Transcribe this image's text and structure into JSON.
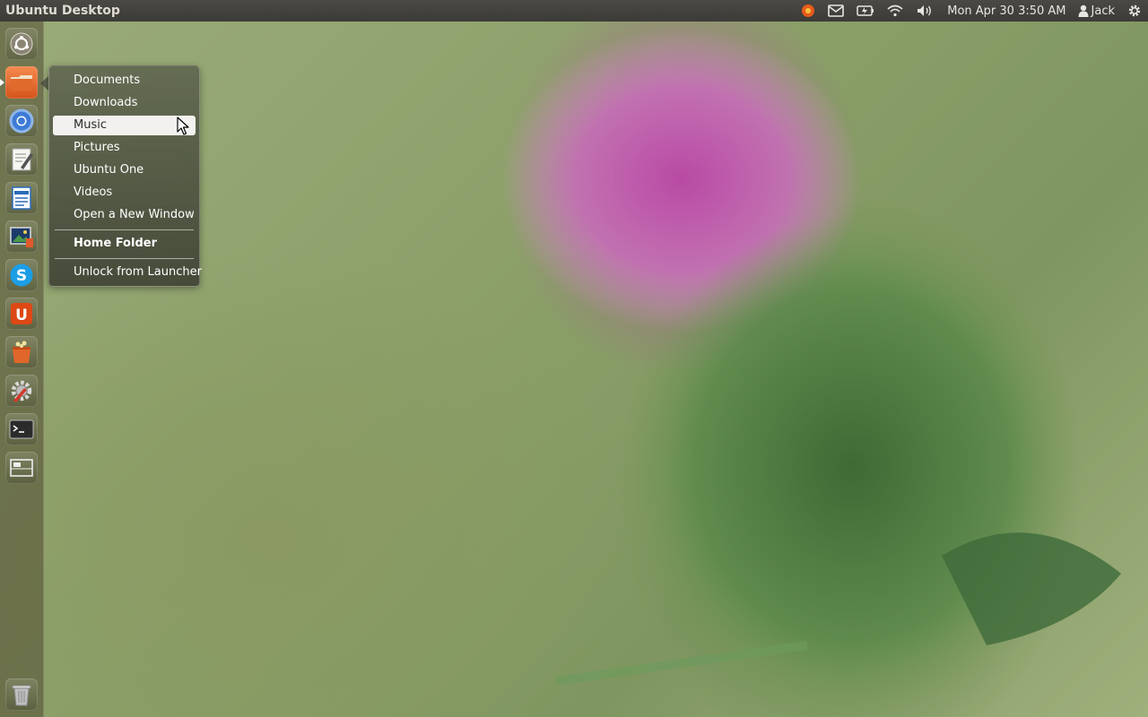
{
  "panel": {
    "title": "Ubuntu Desktop",
    "clock": "Mon Apr 30  3:50 AM",
    "user": "Jack"
  },
  "launcher": {
    "items": [
      {
        "name": "dash-home-icon"
      },
      {
        "name": "home-folder-icon",
        "running": true
      },
      {
        "name": "chromium-icon"
      },
      {
        "name": "text-editor-icon"
      },
      {
        "name": "libreoffice-writer-icon"
      },
      {
        "name": "image-viewer-icon"
      },
      {
        "name": "skype-icon"
      },
      {
        "name": "ubuntu-one-icon"
      },
      {
        "name": "software-center-icon"
      },
      {
        "name": "system-settings-icon"
      },
      {
        "name": "terminal-icon"
      },
      {
        "name": "workspace-switcher-icon"
      },
      {
        "name": "trash-icon"
      }
    ]
  },
  "quicklist": {
    "items": [
      {
        "label": "Documents"
      },
      {
        "label": "Downloads"
      },
      {
        "label": "Music",
        "highlighted": true
      },
      {
        "label": "Pictures"
      },
      {
        "label": "Ubuntu One"
      },
      {
        "label": "Videos"
      },
      {
        "label": "Open a New Window"
      }
    ],
    "home_label": "Home Folder",
    "unlock_label": "Unlock from Launcher"
  },
  "colors": {
    "panel_bg": "#3c3b37",
    "panel_text": "#dfdbd2",
    "highlight": "#f2f1ef",
    "ubuntu_orange": "#dd4814"
  }
}
